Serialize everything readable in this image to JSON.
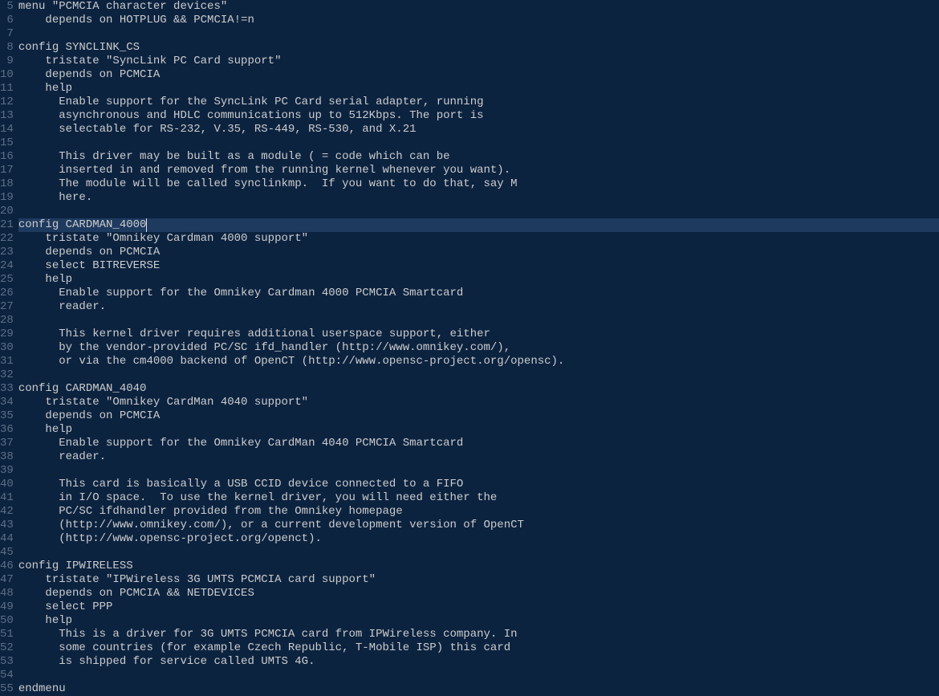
{
  "editor": {
    "current_line_index": 16,
    "cursor_col_ch": 19,
    "lines": [
      {
        "n": 5,
        "text": "menu \"PCMCIA character devices\""
      },
      {
        "n": 6,
        "text": "    depends on HOTPLUG && PCMCIA!=n"
      },
      {
        "n": 7,
        "text": ""
      },
      {
        "n": 8,
        "text": "config SYNCLINK_CS"
      },
      {
        "n": 9,
        "text": "    tristate \"SyncLink PC Card support\""
      },
      {
        "n": 10,
        "text": "    depends on PCMCIA"
      },
      {
        "n": 11,
        "text": "    help"
      },
      {
        "n": 12,
        "text": "      Enable support for the SyncLink PC Card serial adapter, running"
      },
      {
        "n": 13,
        "text": "      asynchronous and HDLC communications up to 512Kbps. The port is"
      },
      {
        "n": 14,
        "text": "      selectable for RS-232, V.35, RS-449, RS-530, and X.21"
      },
      {
        "n": 15,
        "text": ""
      },
      {
        "n": 16,
        "text": "      This driver may be built as a module ( = code which can be"
      },
      {
        "n": 17,
        "text": "      inserted in and removed from the running kernel whenever you want)."
      },
      {
        "n": 18,
        "text": "      The module will be called synclinkmp.  If you want to do that, say M"
      },
      {
        "n": 19,
        "text": "      here."
      },
      {
        "n": 20,
        "text": ""
      },
      {
        "n": 21,
        "text": "config CARDMAN_4000"
      },
      {
        "n": 22,
        "text": "    tristate \"Omnikey Cardman 4000 support\""
      },
      {
        "n": 23,
        "text": "    depends on PCMCIA"
      },
      {
        "n": 24,
        "text": "    select BITREVERSE"
      },
      {
        "n": 25,
        "text": "    help"
      },
      {
        "n": 26,
        "text": "      Enable support for the Omnikey Cardman 4000 PCMCIA Smartcard"
      },
      {
        "n": 27,
        "text": "      reader."
      },
      {
        "n": 28,
        "text": ""
      },
      {
        "n": 29,
        "text": "      This kernel driver requires additional userspace support, either"
      },
      {
        "n": 30,
        "text": "      by the vendor-provided PC/SC ifd_handler (http://www.omnikey.com/),"
      },
      {
        "n": 31,
        "text": "      or via the cm4000 backend of OpenCT (http://www.opensc-project.org/opensc)."
      },
      {
        "n": 32,
        "text": ""
      },
      {
        "n": 33,
        "text": "config CARDMAN_4040"
      },
      {
        "n": 34,
        "text": "    tristate \"Omnikey CardMan 4040 support\""
      },
      {
        "n": 35,
        "text": "    depends on PCMCIA"
      },
      {
        "n": 36,
        "text": "    help"
      },
      {
        "n": 37,
        "text": "      Enable support for the Omnikey CardMan 4040 PCMCIA Smartcard"
      },
      {
        "n": 38,
        "text": "      reader."
      },
      {
        "n": 39,
        "text": ""
      },
      {
        "n": 40,
        "text": "      This card is basically a USB CCID device connected to a FIFO"
      },
      {
        "n": 41,
        "text": "      in I/O space.  To use the kernel driver, you will need either the"
      },
      {
        "n": 42,
        "text": "      PC/SC ifdhandler provided from the Omnikey homepage"
      },
      {
        "n": 43,
        "text": "      (http://www.omnikey.com/), or a current development version of OpenCT"
      },
      {
        "n": 44,
        "text": "      (http://www.opensc-project.org/openct)."
      },
      {
        "n": 45,
        "text": ""
      },
      {
        "n": 46,
        "text": "config IPWIRELESS"
      },
      {
        "n": 47,
        "text": "    tristate \"IPWireless 3G UMTS PCMCIA card support\""
      },
      {
        "n": 48,
        "text": "    depends on PCMCIA && NETDEVICES"
      },
      {
        "n": 49,
        "text": "    select PPP"
      },
      {
        "n": 50,
        "text": "    help"
      },
      {
        "n": 51,
        "text": "      This is a driver for 3G UMTS PCMCIA card from IPWireless company. In"
      },
      {
        "n": 52,
        "text": "      some countries (for example Czech Republic, T-Mobile ISP) this card"
      },
      {
        "n": 53,
        "text": "      is shipped for service called UMTS 4G."
      },
      {
        "n": 54,
        "text": ""
      },
      {
        "n": 55,
        "text": "endmenu"
      }
    ]
  }
}
